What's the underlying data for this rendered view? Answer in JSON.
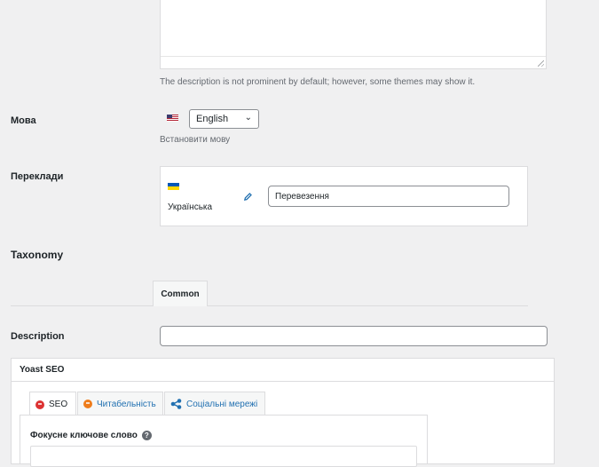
{
  "description_field": {
    "hint": "The description is not prominent by default; however, some themes may show it."
  },
  "language": {
    "label": "Мова",
    "selected": "English",
    "hint": "Встановити мову"
  },
  "translations": {
    "label": "Переклади",
    "language_name": "Українська",
    "input_value": "Перевезення"
  },
  "taxonomy": {
    "heading": "Taxonomy",
    "tab_common": "Common",
    "description_label": "Description"
  },
  "yoast": {
    "title": "Yoast SEO",
    "tabs": [
      {
        "label": "SEO",
        "icon": "sad-face-icon",
        "color": "#dc3232"
      },
      {
        "label": "Читабельність",
        "icon": "neutral-face-icon",
        "color": "#ee7c1b"
      },
      {
        "label": "Соціальні мережі",
        "icon": "share-icon",
        "color": "#2271b1"
      }
    ],
    "focus_keyword_label": "Фокусне ключове слово"
  }
}
